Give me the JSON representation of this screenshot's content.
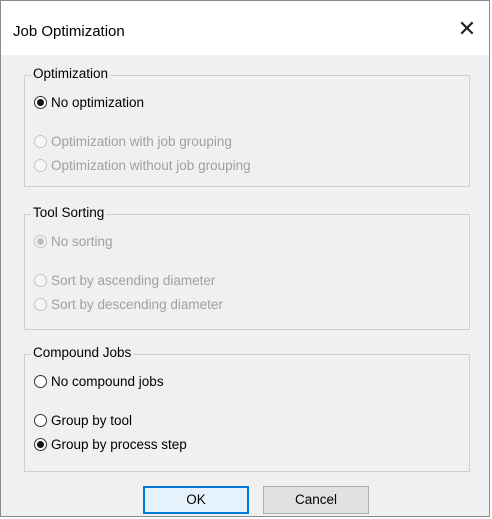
{
  "dialog": {
    "title": "Job Optimization",
    "close_glyph": "✕"
  },
  "groups": {
    "optimization": {
      "title": "Optimization",
      "options": [
        {
          "label": "No optimization",
          "checked": true,
          "disabled": false
        },
        {
          "label": "Optimization with job grouping",
          "checked": false,
          "disabled": true
        },
        {
          "label": "Optimization without job grouping",
          "checked": false,
          "disabled": true
        }
      ]
    },
    "tool_sorting": {
      "title": "Tool Sorting",
      "options": [
        {
          "label": "No sorting",
          "checked": true,
          "disabled": true
        },
        {
          "label": "Sort by ascending diameter",
          "checked": false,
          "disabled": true
        },
        {
          "label": "Sort by descending diameter",
          "checked": false,
          "disabled": true
        }
      ]
    },
    "compound_jobs": {
      "title": "Compound Jobs",
      "options": [
        {
          "label": "No compound jobs",
          "checked": false,
          "disabled": false
        },
        {
          "label": "Group by tool",
          "checked": false,
          "disabled": false
        },
        {
          "label": "Group by process step",
          "checked": true,
          "disabled": false
        }
      ]
    }
  },
  "buttons": {
    "ok": "OK",
    "cancel": "Cancel"
  },
  "colors": {
    "accent": "#0078d7",
    "disabled_text": "#a0a0a0"
  }
}
